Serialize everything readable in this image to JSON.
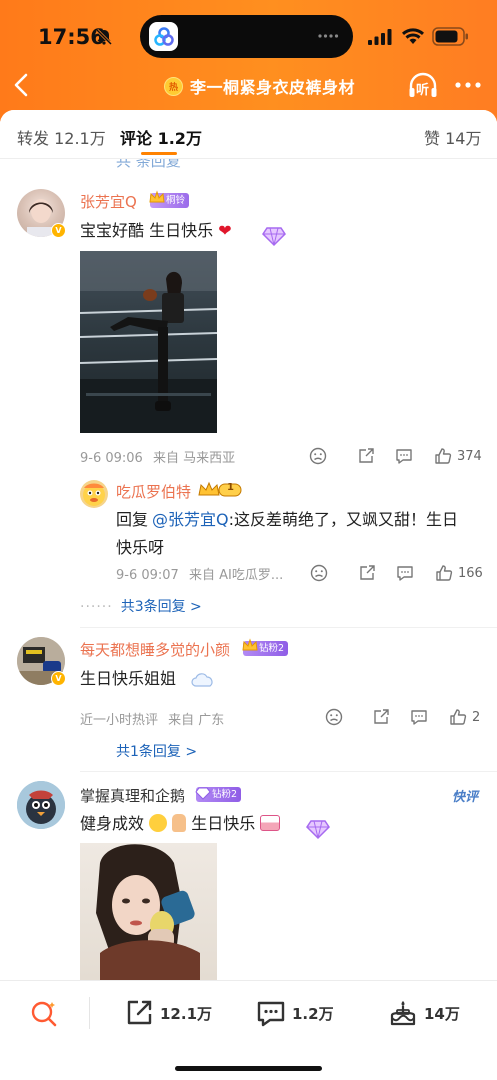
{
  "status_bar": {
    "time": "17:56"
  },
  "header": {
    "title": "李一桐紧身衣皮裤身材",
    "hot_badge": "热",
    "listen_label": "听"
  },
  "tabs": [
    {
      "label": "转发",
      "count": "12.1万"
    },
    {
      "label": "评论",
      "count": "1.2万",
      "active": true
    },
    {
      "label": "赞",
      "count": "14万"
    }
  ],
  "partial_previous": "共 条回复",
  "comments": [
    {
      "user": "张芳宜Q",
      "badge": "桐铃",
      "text": "宝宝好酷 生日快乐",
      "time": "9-6 09:06",
      "location": "来自 马来西亚",
      "likes": "374",
      "reply": {
        "user": "吃瓜罗伯特",
        "level": "1",
        "prefix": "回复",
        "mention": "@张芳宜Q",
        "text_line1": ":这反差萌绝了，又飒又甜！生日",
        "text_line2": "快乐呀",
        "time": "9-6 09:07",
        "location": "来自 AI吃瓜罗...",
        "likes": "166"
      },
      "more_replies": "共3条回复 >"
    },
    {
      "user": "每天都想睡多觉的小颜",
      "badge": "钻粉2",
      "text": "生日快乐姐姐",
      "time": "近一小时热评",
      "location": "来自 广东",
      "likes": "2",
      "more_replies": "共1条回复 >"
    },
    {
      "user": "掌握真理和企鹅",
      "badge": "钻粉2",
      "tag": "快评",
      "text": "健身成效",
      "text_tail": "生日快乐"
    }
  ],
  "bottom_bar": {
    "repost": "12.1万",
    "comment": "1.2万",
    "like": "14万"
  },
  "colors": {
    "brand": "#ff8200",
    "username": "#eb7350",
    "link": "#1d63b8"
  }
}
